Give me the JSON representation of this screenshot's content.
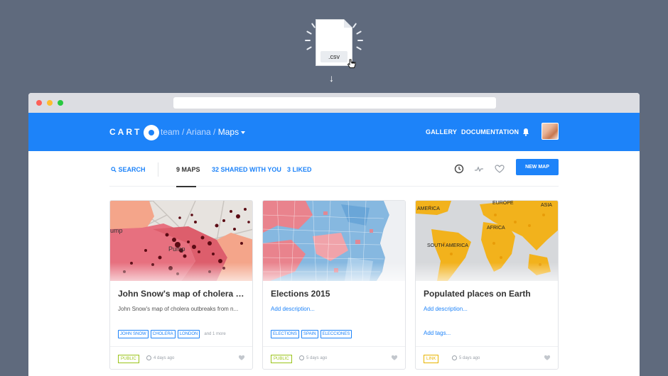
{
  "upload": {
    "file_label": ".csv",
    "icon": "csv-file-icon",
    "arrow_icon": "arrow-down-icon"
  },
  "header": {
    "logo_text": "CARTO",
    "breadcrumb": [
      {
        "label": "team"
      },
      {
        "label": "Ariana"
      },
      {
        "label": "Maps"
      }
    ],
    "nav": [
      {
        "label": "GALLERY"
      },
      {
        "label": "DOCUMENTATION"
      }
    ],
    "bell_icon": "bell-icon",
    "avatar_icon": "avatar",
    "brand_color": "#1d83f9"
  },
  "filters": {
    "search_label": "SEARCH",
    "tabs": [
      {
        "label": "9 MAPS",
        "active": true
      },
      {
        "label": "32 SHARED WITH YOU",
        "active": false
      },
      {
        "label": "3 LIKED",
        "active": false
      }
    ],
    "icons": [
      "clock-icon",
      "activity-icon",
      "heart-icon"
    ],
    "new_map_label": "NEW MAP"
  },
  "cards": [
    {
      "title": "John Snow's map of cholera outb...",
      "description": "John Snow's map of cholera outbreaks from n...",
      "tags": [
        "JOHN SNOW",
        "CHOLERA",
        "LONDON"
      ],
      "more_tags": "and 1 more",
      "privacy": "PUBLIC",
      "date": "4 days ago",
      "thumb_labels": [
        "ump",
        "Pump"
      ]
    },
    {
      "title": "Elections 2015",
      "description": "Add description...",
      "tags": [
        "ELECTIONS",
        "SPAIN",
        "ELECCIONES"
      ],
      "more_tags": "",
      "privacy": "PUBLIC",
      "date": "5 days ago",
      "thumb_labels": []
    },
    {
      "title": "Populated places on Earth",
      "description": "Add description...",
      "tags": [],
      "add_tags": "Add tags...",
      "more_tags": "",
      "privacy": "LINK",
      "date": "5 days ago",
      "thumb_labels": [
        "EUROPE",
        "ASIA",
        "AMERICA",
        "AFRICA",
        "SOUTH AMERICA"
      ]
    }
  ]
}
